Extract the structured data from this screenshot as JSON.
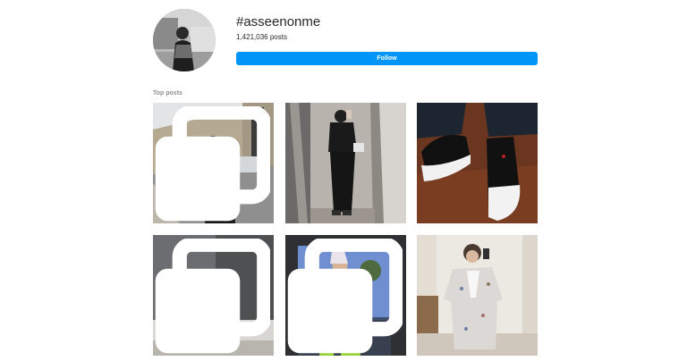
{
  "hashtag": {
    "title": "#asseenonme",
    "post_count": "1,421,036",
    "post_count_suffix": "posts",
    "follow_label": "Follow",
    "avatar_icon": "hashtag-avatar"
  },
  "section": {
    "label": "Top posts"
  },
  "posts": [
    {
      "icon": "street-photo",
      "multi": true
    },
    {
      "icon": "mirror-selfie",
      "multi": false
    },
    {
      "icon": "sneakers",
      "multi": false
    },
    {
      "icon": "wall-pose",
      "multi": true
    },
    {
      "icon": "green-trousers",
      "multi": true
    },
    {
      "icon": "blazer-mirror",
      "multi": false
    }
  ],
  "colors": {
    "accent": "#0095f6",
    "text": "#262626",
    "muted": "#8e8e8e"
  }
}
